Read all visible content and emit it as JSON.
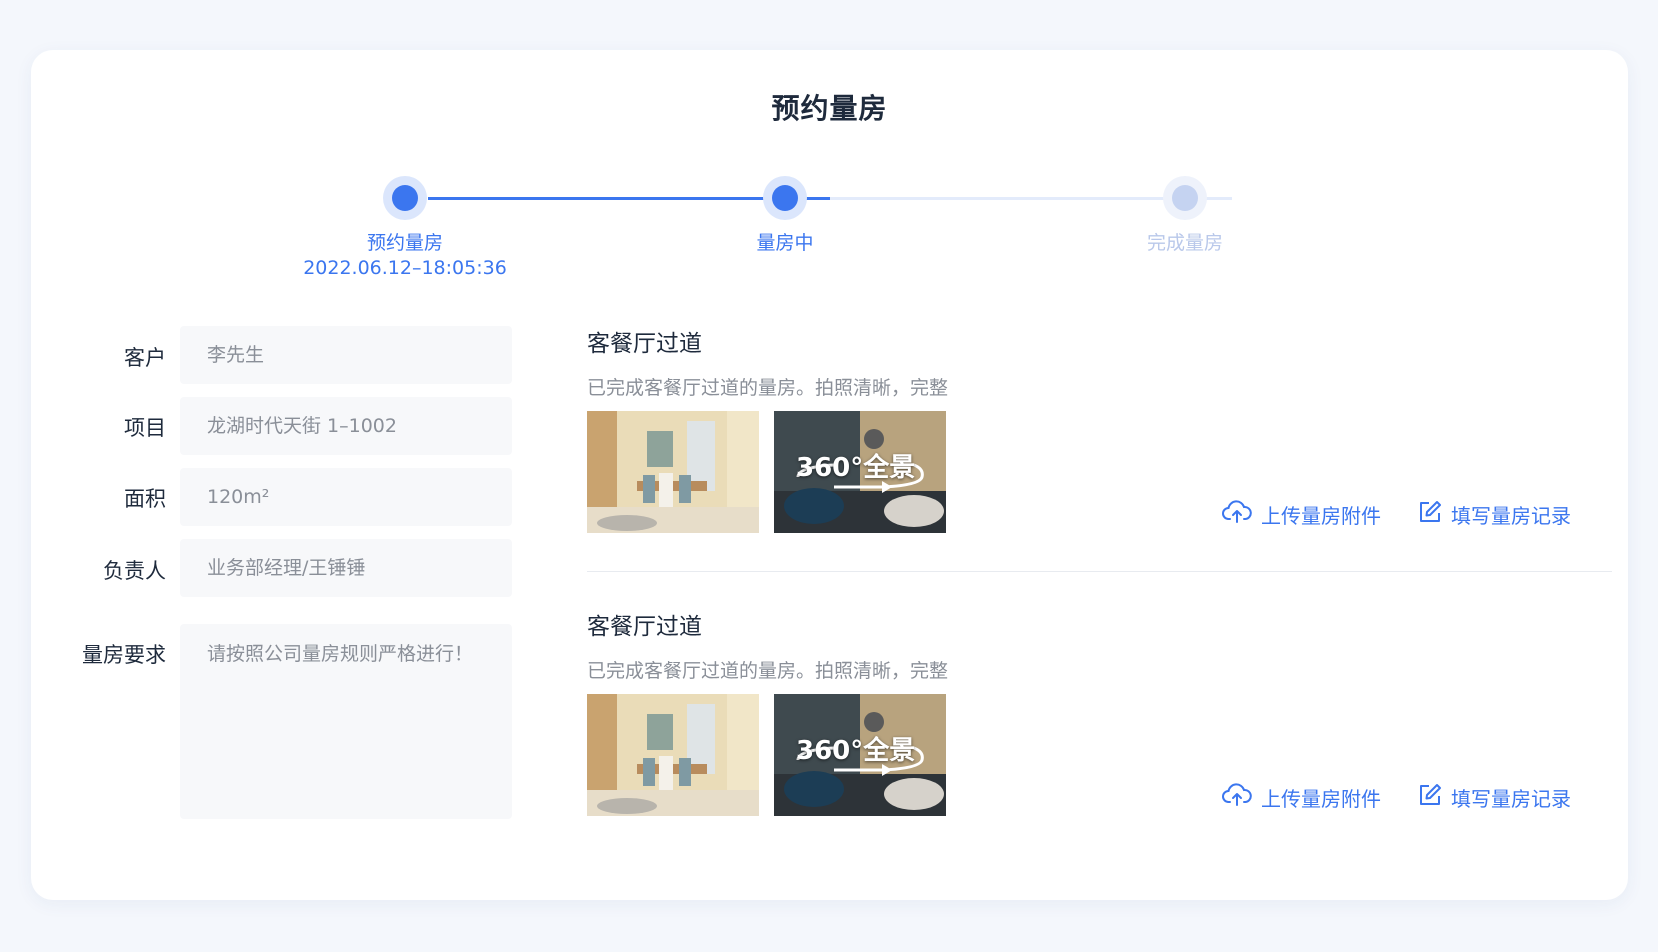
{
  "page": {
    "title": "预约量房"
  },
  "steps": [
    {
      "label": "预约量房",
      "time": "2022.06.12–18:05:36",
      "state": "done"
    },
    {
      "label": "量房中",
      "state": "active"
    },
    {
      "label": "完成量房",
      "state": "todo"
    }
  ],
  "form": {
    "customer_label": "客户",
    "customer_value": "李先生",
    "project_label": "项目",
    "project_value": "龙湖时代天街 1–1002",
    "area_label": "面积",
    "area_value": "120m²",
    "owner_label": "负责人",
    "owner_value": "业务部经理/王锤锤",
    "requirement_label": "量房要求",
    "requirement_value": "请按照公司量房规则严格进行！"
  },
  "records": [
    {
      "title": "客餐厅过道",
      "desc": "已完成客餐厅过道的量房。拍照清晰，完整",
      "pano_label": "360°全景",
      "upload_label": "上传量房附件",
      "upload_icon": "cloud-upload-icon",
      "fill_label": "填写量房记录",
      "fill_icon": "edit-icon"
    },
    {
      "title": "客餐厅过道",
      "desc": "已完成客餐厅过道的量房。拍照清晰，完整",
      "pano_label": "360°全景",
      "upload_label": "上传量房附件",
      "upload_icon": "cloud-upload-icon",
      "fill_label": "填写量房记录",
      "fill_icon": "edit-icon"
    }
  ],
  "colors": {
    "accent": "#3b76ef",
    "accent_light": "#dbe6fc",
    "todo": "#c5d3f1",
    "field_bg": "#f7f8fa"
  }
}
